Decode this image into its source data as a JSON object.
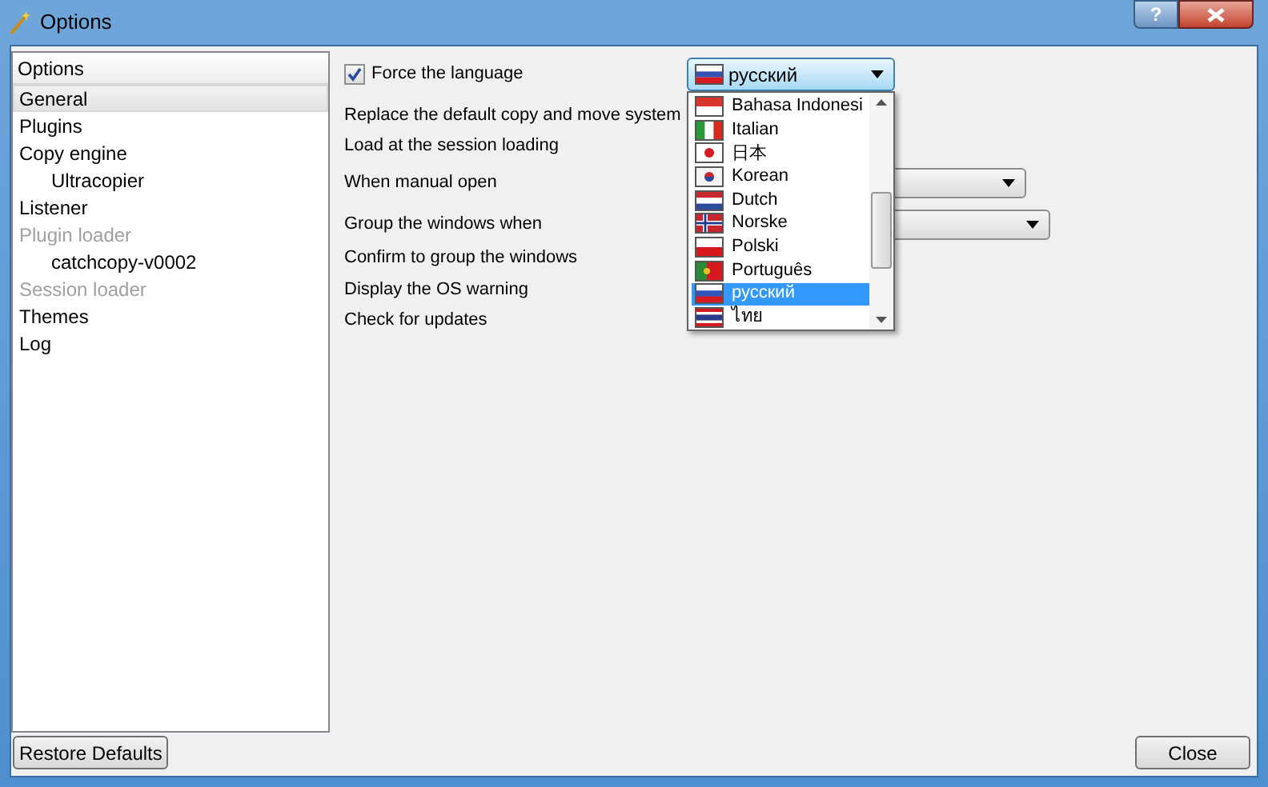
{
  "window": {
    "title": "Options",
    "help_button": "?"
  },
  "sidebar": {
    "header": "Options",
    "items": [
      {
        "label": "General",
        "selected": true,
        "disabled": false
      },
      {
        "label": "Plugins",
        "selected": false,
        "disabled": false
      },
      {
        "label": "Copy engine",
        "selected": false,
        "disabled": false,
        "children": [
          {
            "label": "Ultracopier",
            "selected": false,
            "disabled": false
          }
        ]
      },
      {
        "label": "Listener",
        "selected": false,
        "disabled": false
      },
      {
        "label": "Plugin loader",
        "selected": false,
        "disabled": true,
        "children": [
          {
            "label": "catchcopy-v0002",
            "selected": false,
            "disabled": false
          }
        ]
      },
      {
        "label": "Session loader",
        "selected": false,
        "disabled": true
      },
      {
        "label": "Themes",
        "selected": false,
        "disabled": false
      },
      {
        "label": "Log",
        "selected": false,
        "disabled": false
      }
    ]
  },
  "settings": [
    {
      "kind": "checkbox",
      "label": "Force the language",
      "checked": true
    },
    {
      "kind": "label",
      "label": "Replace the default copy and move system"
    },
    {
      "kind": "label",
      "label": "Load at the session loading"
    },
    {
      "kind": "combo",
      "label": "When manual open"
    },
    {
      "kind": "combo",
      "label": "Group the windows when"
    },
    {
      "kind": "label",
      "label": "Confirm to group the windows"
    },
    {
      "kind": "label",
      "label": "Display the OS warning"
    },
    {
      "kind": "label",
      "label": "Check for updates"
    }
  ],
  "language_combo": {
    "value": "русский",
    "options": [
      {
        "label": "Bahasa Indonesi",
        "kind": "id",
        "selected": false
      },
      {
        "label": "Italian",
        "kind": "it",
        "selected": false
      },
      {
        "label": "日本",
        "kind": "jp",
        "selected": false
      },
      {
        "label": "Korean",
        "kind": "kr",
        "selected": false
      },
      {
        "label": "Dutch",
        "kind": "nl",
        "selected": false
      },
      {
        "label": "Norske",
        "kind": "no",
        "selected": false
      },
      {
        "label": "Polski",
        "kind": "pl",
        "selected": false
      },
      {
        "label": "Português",
        "kind": "pt",
        "selected": false
      },
      {
        "label": "русский",
        "kind": "ru",
        "selected": true
      },
      {
        "label": "ไทย",
        "kind": "th",
        "selected": false
      }
    ]
  },
  "buttons": {
    "restore": "Restore Defaults",
    "close": "Close"
  }
}
